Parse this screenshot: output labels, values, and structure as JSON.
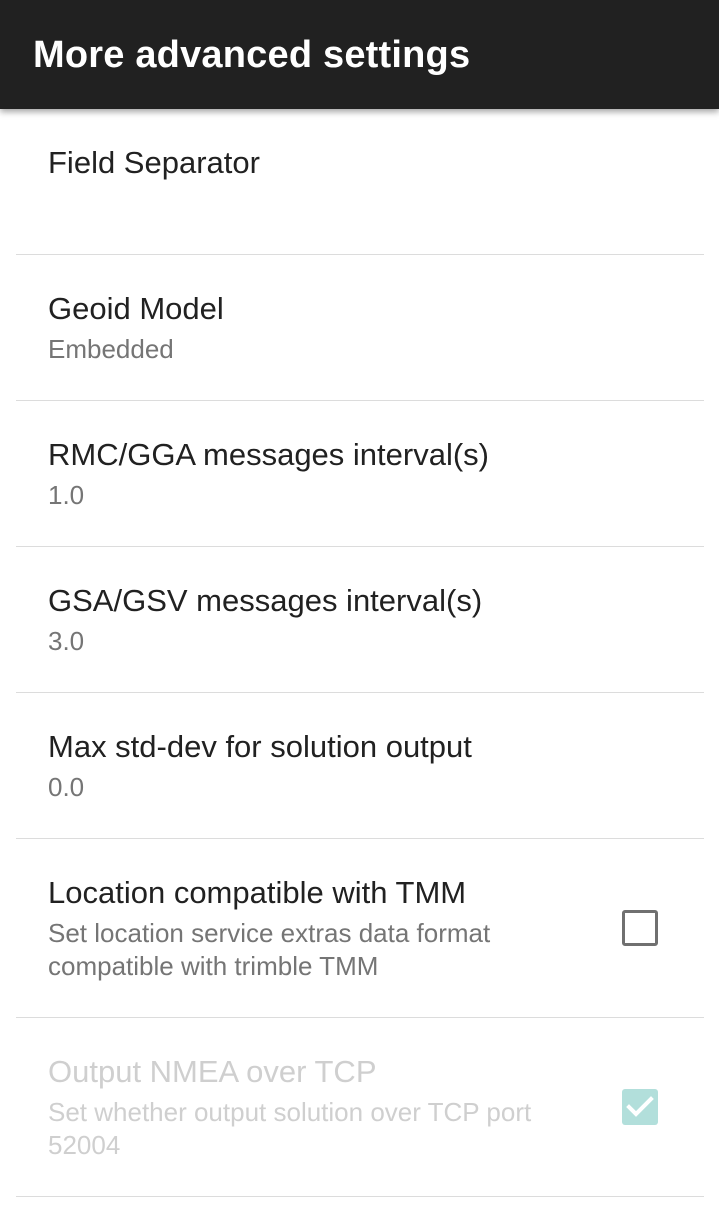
{
  "app_bar": {
    "title": "More advanced settings"
  },
  "preferences": [
    {
      "title": "Field Separator",
      "summary": ""
    },
    {
      "title": "Geoid Model",
      "summary": "Embedded"
    },
    {
      "title": "RMC/GGA messages interval(s)",
      "summary": "1.0"
    },
    {
      "title": "GSA/GSV messages interval(s)",
      "summary": "3.0"
    },
    {
      "title": "Max std-dev for solution output",
      "summary": "0.0"
    },
    {
      "title": "Location compatible with TMM",
      "summary": "Set location service extras data format compatible with trimble TMM",
      "checkbox": {
        "checked": false,
        "enabled": true
      }
    },
    {
      "title": "Output NMEA over TCP",
      "summary": "Set whether output solution over TCP port 52004",
      "checkbox": {
        "checked": true,
        "enabled": false
      }
    }
  ],
  "colors": {
    "app_bar": "#212121",
    "title_text": "#212121",
    "summary_text": "#757575",
    "disabled_text": "#cfcfcf",
    "checkbox_disabled_checked": "#b2dfdb"
  }
}
